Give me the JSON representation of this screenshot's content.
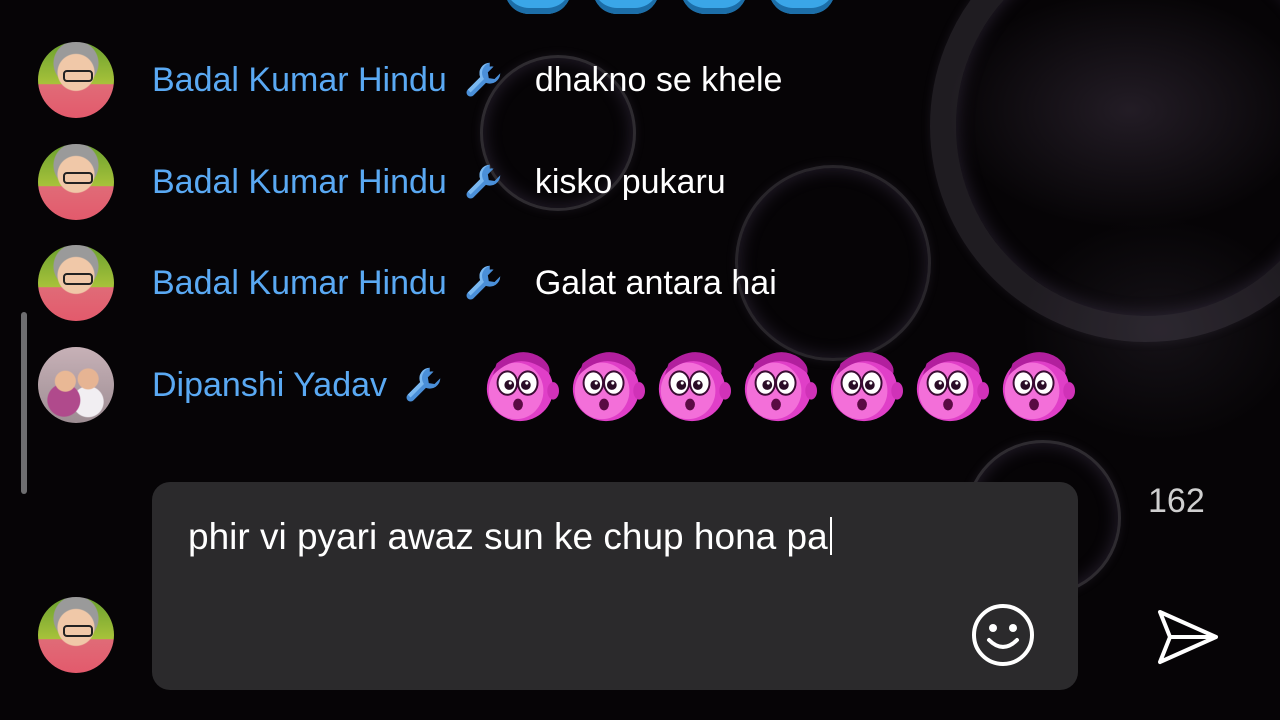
{
  "chat": {
    "messages": [
      {
        "author": "Badal Kumar Hindu",
        "text": "dhakno se khele",
        "avatar": "man-grey-hair-glasses"
      },
      {
        "author": "Badal Kumar Hindu",
        "text": "kisko pukaru",
        "avatar": "man-grey-hair-glasses"
      },
      {
        "author": "Badal Kumar Hindu",
        "text": "Galat antara hai",
        "avatar": "man-grey-hair-glasses"
      },
      {
        "author": "Dipanshi Yadav",
        "sticker_count": 7,
        "sticker": "pink-surprised-creature",
        "avatar": "two-girls"
      }
    ],
    "moderator_icon": "wrench-icon"
  },
  "composer": {
    "value": "phir vi pyari awaz sun ke chup hona pa",
    "char_remaining": "162",
    "emoji_icon": "smiley-icon",
    "send_icon": "send-icon"
  },
  "colors": {
    "username": "#5aa9f3",
    "message_text": "#ffffff",
    "composer_bg": "#2b2a2c",
    "background": "#060406"
  }
}
